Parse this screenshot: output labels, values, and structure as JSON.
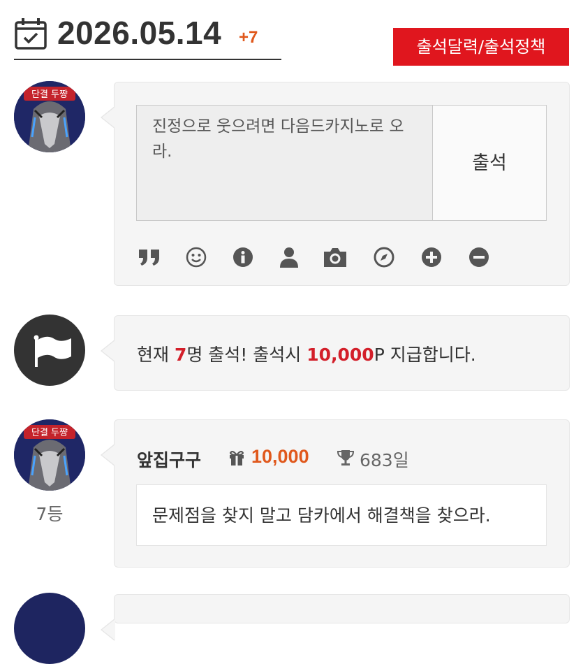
{
  "header": {
    "date": "2026.05.14",
    "attendee_increment": "+7",
    "policy_button": "출석달력/출석정책"
  },
  "composer": {
    "text_line1": "진정으로 웃으려면 다음드카지노로 오",
    "text_line2": "라.",
    "submit_label": "출석",
    "tools": [
      "quote-icon",
      "smiley-icon",
      "info-icon",
      "user-icon",
      "camera-icon",
      "compass-icon",
      "plus-circle-icon",
      "minus-circle-icon"
    ]
  },
  "notice": {
    "prefix": "현재 ",
    "count": "7",
    "middle": "명 출석! 출석시 ",
    "points": "10,000",
    "suffix": "P 지급합니다."
  },
  "entries": [
    {
      "rank": "7등",
      "username": "앞집구구",
      "points": "10,000",
      "days": "683일",
      "comment": "문제점을 찾지 말고 담카에서 해결책을 찾으라."
    }
  ],
  "colors": {
    "accent_red": "#e0161e",
    "points_orange": "#e0581c",
    "notice_red": "#d31f2a"
  }
}
